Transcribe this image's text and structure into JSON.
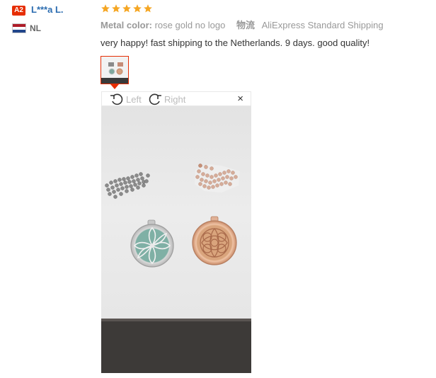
{
  "reviewer": {
    "level_badge": "A2",
    "name": "L***a L.",
    "country": "NL",
    "flag_colors": [
      "#ae1c28",
      "#ffffff",
      "#21468b"
    ]
  },
  "rating": {
    "stars": 5,
    "max": 5,
    "color": "#f5a623"
  },
  "attributes": {
    "color_label": "Metal color:",
    "color_value": "rose gold no logo",
    "shipping_label": "物流",
    "shipping_value": "AliExpress Standard Shipping"
  },
  "review_text": "very happy! fast shipping to the Netherlands. 9 days. good quality!",
  "viewer": {
    "rotate_left": "Left",
    "rotate_right": "Right",
    "close": "×"
  },
  "colors": {
    "accent": "#e62e04",
    "link": "#2b6cb0"
  }
}
